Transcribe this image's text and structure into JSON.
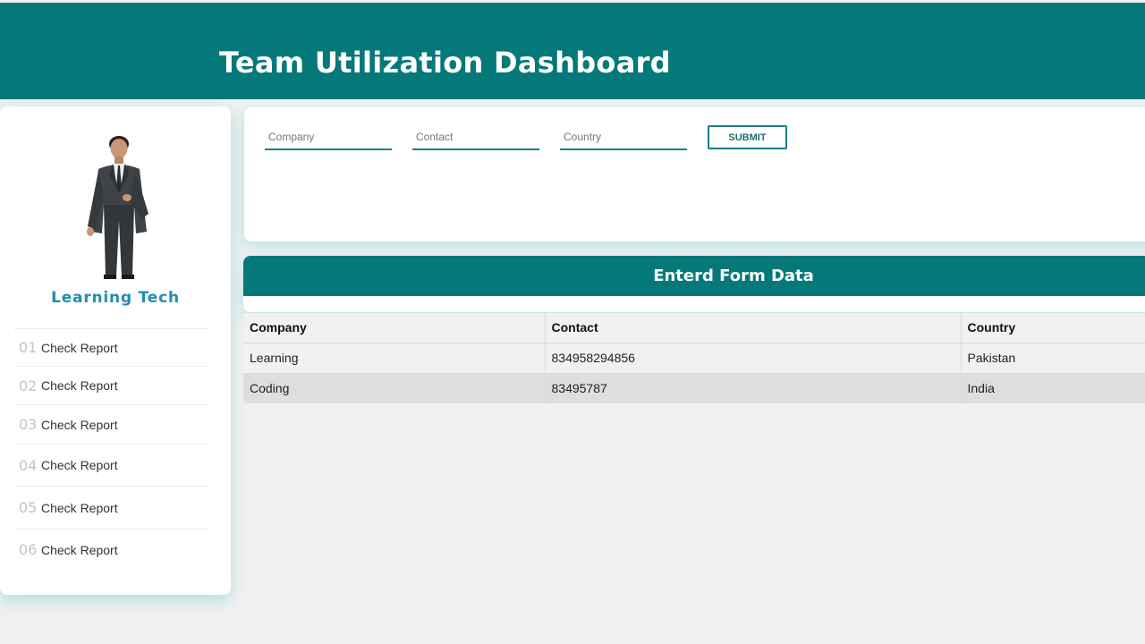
{
  "header": {
    "title": "Team Utilization Dashboard"
  },
  "sidebar": {
    "brand": "Learning Tech",
    "items": [
      {
        "num": "01",
        "label": "Check Report"
      },
      {
        "num": "02",
        "label": "Check Report"
      },
      {
        "num": "03",
        "label": "Check Report"
      },
      {
        "num": "04",
        "label": "Check Report"
      },
      {
        "num": "05",
        "label": "Check Report"
      },
      {
        "num": "06",
        "label": "Check Report"
      }
    ]
  },
  "form": {
    "company": {
      "placeholder": "Company",
      "value": ""
    },
    "contact": {
      "placeholder": "Contact",
      "value": ""
    },
    "country": {
      "placeholder": "Country",
      "value": ""
    },
    "submit_label": "SUBMIT"
  },
  "data_section": {
    "title": "Enterd Form Data",
    "columns": [
      "Company",
      "Contact",
      "Country"
    ],
    "rows": [
      [
        "Learning",
        "834958294856",
        "Pakistan"
      ],
      [
        "Coding",
        "83495787",
        "India"
      ]
    ]
  },
  "colors": {
    "accent": "#05787a",
    "brand_text": "#1e8fb0"
  },
  "icons": {
    "avatar": "businessman-avatar"
  }
}
